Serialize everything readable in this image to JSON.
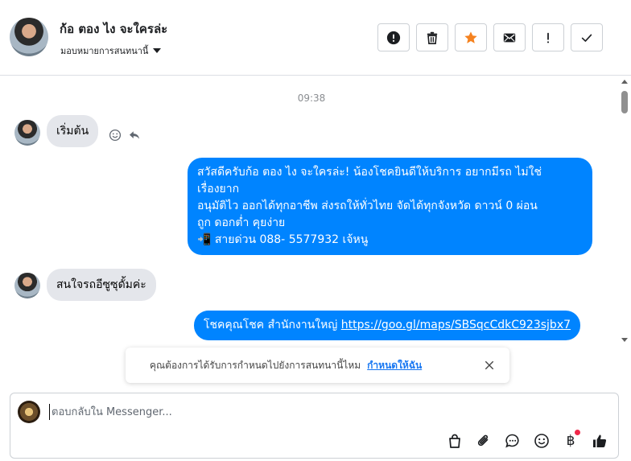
{
  "header": {
    "contact_name": "ก้อ ตอง ไง จะใครล่ะ",
    "assign_label": "มอบหมายการสนทนานี้",
    "toolbar": {
      "spam_icon": "alert-circle-icon",
      "delete_icon": "trash-icon",
      "star_icon": "star-icon",
      "mail_icon": "envelope-icon",
      "follow_up_icon": "exclamation-icon",
      "done_icon": "check-icon",
      "star_color": "#f5821f"
    }
  },
  "messages": {
    "timestamp": "09:38",
    "items": [
      {
        "from": "contact",
        "text": "เริ่มต้น"
      },
      {
        "from": "page",
        "lines": [
          "สวัสดีครับก้อ ตอง ไง จะใครล่ะ! น้องโชคยินดีให้บริการ อยากมีรถ ไม่ใช่",
          "เรื่องยาก",
          "อนุมัติไว ออกได้ทุกอาชีพ ส่งรถให้ทั่วไทย จัดได้ทุกจังหวัด ดาวน์ 0  ผ่อน",
          "ถูก ดอกต่ำ คุยง่าย",
          "📲 สายด่วน 088- 5577932 เจ้หนู"
        ]
      },
      {
        "from": "contact",
        "text": "สนใจรถอีซูซุดั้มค่ะ"
      },
      {
        "from": "page",
        "prefix": "โชคคุณโชค สำนักงานใหญ่ ",
        "link": "https://goo.gl/maps/SBSqcCdkC923sjbx7"
      }
    ]
  },
  "banner": {
    "text": "คุณต้องการได้รับการกำหนดไปยังการสนทนานี้ไหม",
    "link": "กำหนดให้ฉัน"
  },
  "composer": {
    "placeholder": "ตอบกลับใน Messenger...",
    "value": "",
    "baht_symbol": "฿",
    "accent_color": "#0084ff"
  }
}
